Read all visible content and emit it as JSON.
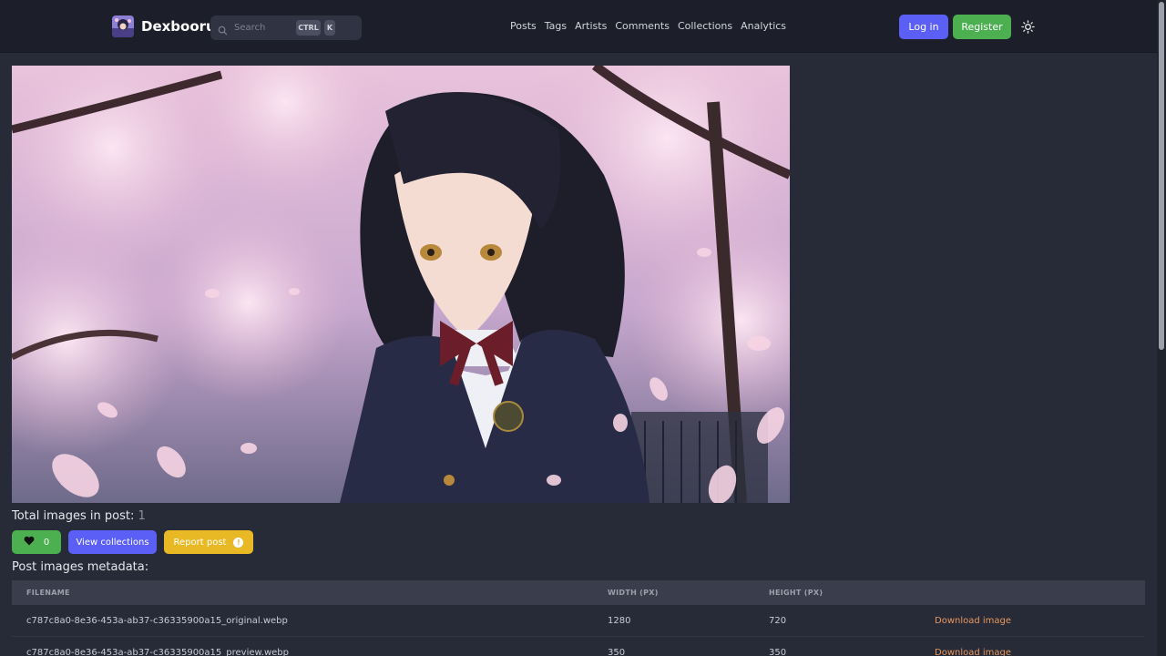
{
  "header": {
    "brand": "Dexbooru",
    "search": {
      "placeholder": "Search",
      "shortcut_keys": [
        "CTRL",
        "K"
      ]
    },
    "nav_links": [
      "Posts",
      "Tags",
      "Artists",
      "Comments",
      "Collections",
      "Analytics"
    ],
    "login_label": "Log in",
    "register_label": "Register",
    "theme_toggle_icon": "sun-icon"
  },
  "post": {
    "total_images_label": "Total images in post:",
    "total_images_count": "1",
    "like_count": "0",
    "view_collections_label": "View collections",
    "report_label": "Report post",
    "metadata_title": "Post images metadata:",
    "table": {
      "columns": [
        "FILENAME",
        "WIDTH (PX)",
        "HEIGHT (PX)",
        ""
      ],
      "rows": [
        {
          "filename": "c787c8a0-8e36-453a-ab37-c36335900a15_original.webp",
          "width": "1280",
          "height": "720",
          "action": "Download image"
        },
        {
          "filename": "c787c8a0-8e36-453a-ab37-c36335900a15_preview.webp",
          "width": "350",
          "height": "350",
          "action": "Download image"
        }
      ]
    }
  },
  "colors": {
    "primary": "#5b5ff5",
    "success": "#4caf50",
    "warning": "#e8b925",
    "link": "#e8975c",
    "background": "#272b38",
    "navbar": "#1c1f29"
  }
}
